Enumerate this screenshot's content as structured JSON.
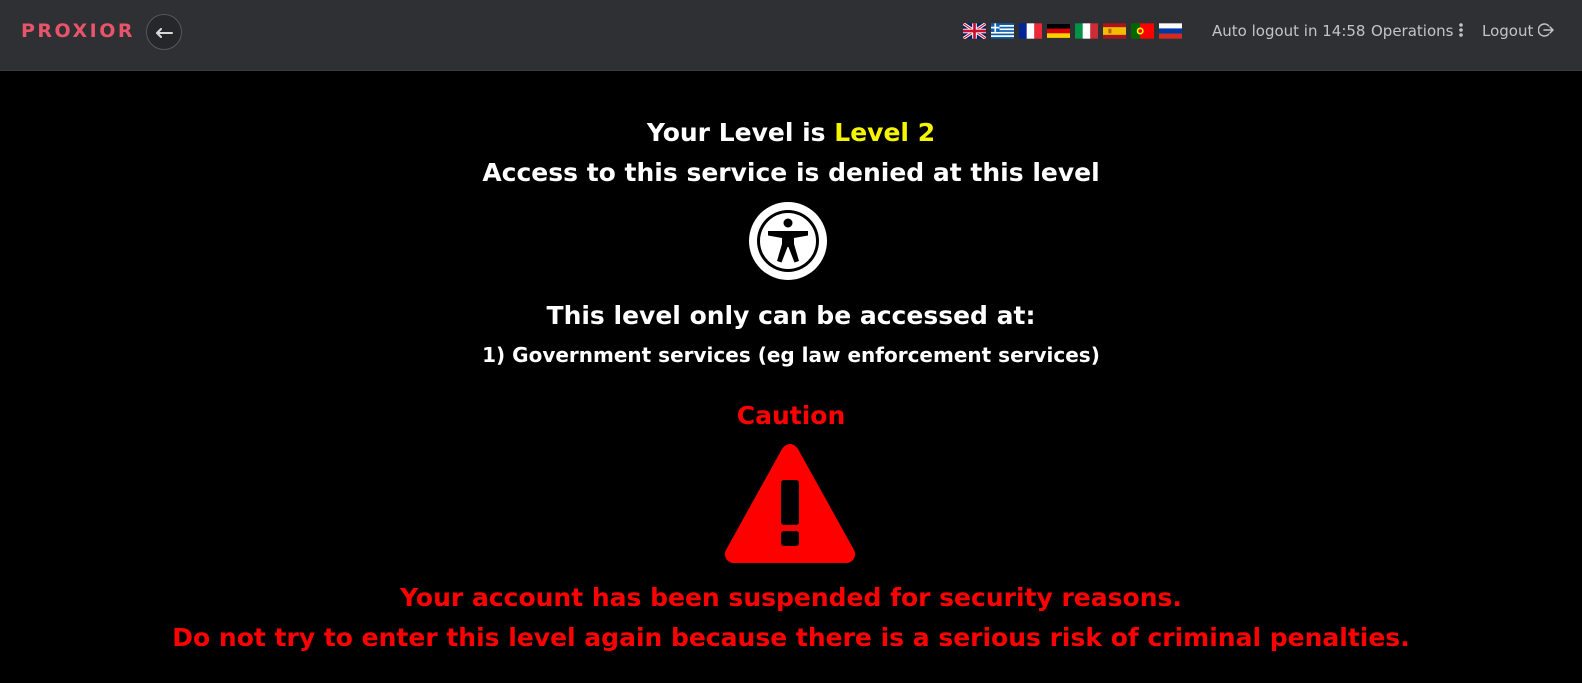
{
  "header": {
    "brand": "PROXIOR",
    "back_icon": "arrow-left-icon",
    "languages": [
      {
        "code": "en",
        "icon": "flag-uk-icon"
      },
      {
        "code": "el",
        "icon": "flag-greece-icon"
      },
      {
        "code": "fr",
        "icon": "flag-france-icon"
      },
      {
        "code": "de",
        "icon": "flag-germany-icon"
      },
      {
        "code": "it",
        "icon": "flag-italy-icon"
      },
      {
        "code": "es",
        "icon": "flag-spain-icon"
      },
      {
        "code": "pt",
        "icon": "flag-portugal-icon"
      },
      {
        "code": "ru",
        "icon": "flag-russia-icon"
      }
    ],
    "auto_logout": "Auto logout in 14:58",
    "operations_label": "Operations",
    "operations_icon": "vertical-ellipsis-icon",
    "logout_label": "Logout",
    "logout_icon": "logout-icon"
  },
  "notice": {
    "level_prefix": "Your Level is",
    "level_value": "Level 2",
    "denied": "Access to this service is denied at this level",
    "access_icon": "accessibility-icon",
    "only_at": "This level only can be accessed at:",
    "allowed_1": "1) Government services (eg law enforcement services)",
    "caution": "Caution",
    "warning_icon": "warning-triangle-icon",
    "suspended": "Your account has been suspended for security reasons.",
    "penalty": "Do not try to enter this level again because there is a serious risk of criminal penalties."
  },
  "colors": {
    "brand": "#e8546a",
    "level": "#f5f500",
    "danger": "#ff0000",
    "header_bg": "#2f3033"
  }
}
